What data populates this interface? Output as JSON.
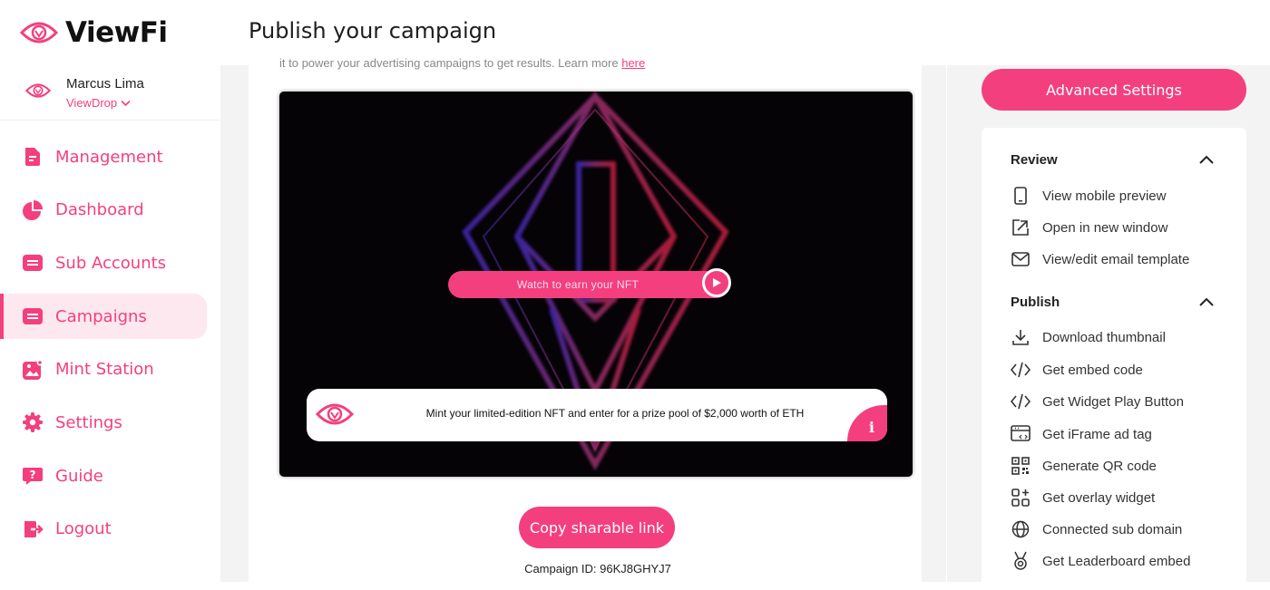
{
  "app": {
    "name": "ViewFi"
  },
  "header": {
    "title": "Publish your campaign"
  },
  "user": {
    "name": "Marcus Lima",
    "org": "ViewDrop"
  },
  "sidebar": {
    "items": [
      {
        "label": "Management",
        "icon": "document-icon"
      },
      {
        "label": "Dashboard",
        "icon": "pie-chart-icon"
      },
      {
        "label": "Sub Accounts",
        "icon": "card-icon"
      },
      {
        "label": "Campaigns",
        "icon": "card-icon",
        "active": true
      },
      {
        "label": "Mint Station",
        "icon": "image-plus-icon"
      },
      {
        "label": "Settings",
        "icon": "gear-icon"
      },
      {
        "label": "Guide",
        "icon": "help-bubble-icon"
      },
      {
        "label": "Logout",
        "icon": "logout-icon"
      }
    ]
  },
  "main": {
    "intro_text": "it to power your advertising campaigns to get results. Learn more",
    "intro_link": "here",
    "video": {
      "watch_label": "Watch to earn your NFT",
      "info_text": "Mint your limited-edition NFT and enter for a prize pool of $2,000 worth of ETH",
      "info_badge": "i"
    },
    "copy_button": "Copy sharable link",
    "campaign_id": "Campaign ID: 96KJ8GHYJ7"
  },
  "right": {
    "advanced_button": "Advanced Settings",
    "review": {
      "title": "Review",
      "items": [
        {
          "label": "View mobile preview",
          "icon": "mobile-icon"
        },
        {
          "label": "Open in new window",
          "icon": "external-link-icon"
        },
        {
          "label": "View/edit email template",
          "icon": "mail-icon"
        }
      ]
    },
    "publish": {
      "title": "Publish",
      "items": [
        {
          "label": "Download thumbnail",
          "icon": "download-icon"
        },
        {
          "label": "Get embed code",
          "icon": "code-icon"
        },
        {
          "label": "Get Widget Play Button",
          "icon": "code-icon"
        },
        {
          "label": "Get iFrame ad tag",
          "icon": "iframe-icon"
        },
        {
          "label": "Generate QR code",
          "icon": "qr-icon"
        },
        {
          "label": "Get overlay widget",
          "icon": "widget-add-icon"
        },
        {
          "label": "Connected sub domain",
          "icon": "globe-icon"
        },
        {
          "label": "Get Leaderboard embed",
          "icon": "trophy-icon"
        }
      ]
    }
  },
  "colors": {
    "accent": "#f43f7e",
    "active_bg": "#fde8ef",
    "panel_bg": "#f3f3f3"
  }
}
